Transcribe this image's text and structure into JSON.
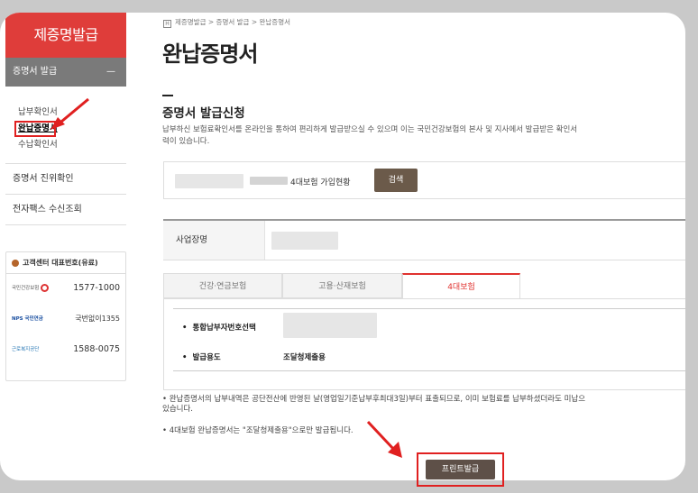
{
  "sidebar": {
    "title": "제증명발급",
    "section": "증명서 발급",
    "section_toggle": "—",
    "sub_items": [
      "납부확인서",
      "완납증명서",
      "수납확인서"
    ],
    "menu": [
      "증명서 진위확인",
      "전자팩스 수신조회"
    ],
    "customer_center": {
      "title": "고객센터 대표번호(유료)",
      "rows": [
        {
          "logo": "국민건강보험",
          "number": "1577-1000"
        },
        {
          "logo": "NPS 국민연금",
          "number": "국번없이1355"
        },
        {
          "logo": "근로복지공단",
          "number": "1588-0075"
        }
      ]
    }
  },
  "breadcrumb": {
    "icon": "H",
    "text": "제증명발급 >  증명서 발급 >  완납증명서"
  },
  "page_title": "완납증명서",
  "section_title": "증명서 발급신청",
  "description": [
    "납부하신 보험료확인서를 온라인을 통하여 편리하게 발급받으실 수 있으며 이는 국민건강보험의 본사 및 지사에서 발급받은 확인서",
    "력이 있습니다."
  ],
  "search": {
    "label": "4대보험 가입현황",
    "button": "검색"
  },
  "business": {
    "label": "사업장명"
  },
  "tabs": [
    "건강·연금보험",
    "고용·산재보험",
    "4대보험"
  ],
  "panel": {
    "rows": [
      {
        "label": "통합납부자번호선택",
        "value": ""
      },
      {
        "label": "발급용도",
        "value": "조달청제출용"
      }
    ]
  },
  "notes": [
    "• 완납증명서의 납부내역은 공단전산에 반영된 날(영업일기준납부후최대3일)부터 표출되므로, 이미 보험료를 납부하셨더라도 미납으",
    "  있습니다.",
    "• 4대보험 완납증명서는 \"조달청제출용\"으로만 발급됩니다."
  ],
  "print_button": "프린트발급",
  "colors": {
    "brand_red": "#df3d3a",
    "button_brown": "#6b5a4a",
    "highlight": "#e02020"
  }
}
